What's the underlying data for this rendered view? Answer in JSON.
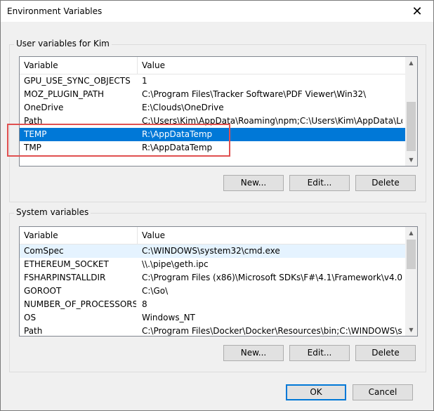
{
  "window": {
    "title": "Environment Variables",
    "close_glyph": "✕"
  },
  "user_vars": {
    "group_title": "User variables for Kim",
    "header": {
      "variable": "Variable",
      "value": "Value"
    },
    "rows": [
      {
        "variable": "GPU_USE_SYNC_OBJECTS",
        "value": "1"
      },
      {
        "variable": "MOZ_PLUGIN_PATH",
        "value": "C:\\Program Files\\Tracker Software\\PDF Viewer\\Win32\\"
      },
      {
        "variable": "OneDrive",
        "value": "E:\\Clouds\\OneDrive"
      },
      {
        "variable": "Path",
        "value": "C:\\Users\\Kim\\AppData\\Roaming\\npm;C:\\Users\\Kim\\AppData\\Loc..."
      },
      {
        "variable": "TEMP",
        "value": "R:\\AppDataTemp",
        "selected": true
      },
      {
        "variable": "TMP",
        "value": "R:\\AppDataTemp"
      }
    ],
    "buttons": {
      "new": "New...",
      "edit": "Edit...",
      "delete": "Delete"
    }
  },
  "system_vars": {
    "group_title": "System variables",
    "header": {
      "variable": "Variable",
      "value": "Value"
    },
    "rows": [
      {
        "variable": "ComSpec",
        "value": "C:\\WINDOWS\\system32\\cmd.exe",
        "hover": true
      },
      {
        "variable": "ETHEREUM_SOCKET",
        "value": "\\\\.\\pipe\\geth.ipc"
      },
      {
        "variable": "FSHARPINSTALLDIR",
        "value": "C:\\Program Files (x86)\\Microsoft SDKs\\F#\\4.1\\Framework\\v4.0\\"
      },
      {
        "variable": "GOROOT",
        "value": "C:\\Go\\"
      },
      {
        "variable": "NUMBER_OF_PROCESSORS",
        "value": "8"
      },
      {
        "variable": "OS",
        "value": "Windows_NT"
      },
      {
        "variable": "Path",
        "value": "C:\\Program Files\\Docker\\Docker\\Resources\\bin;C:\\WINDOWS\\syst..."
      }
    ],
    "buttons": {
      "new": "New...",
      "edit": "Edit...",
      "delete": "Delete"
    }
  },
  "footer": {
    "ok": "OK",
    "cancel": "Cancel"
  },
  "colors": {
    "selection": "#0078d7",
    "annotation": "#e05050",
    "default_button_border": "#0078d7"
  },
  "icons": {
    "close": "close-icon",
    "scroll_up": "chevron-up-icon",
    "scroll_down": "chevron-down-icon"
  }
}
